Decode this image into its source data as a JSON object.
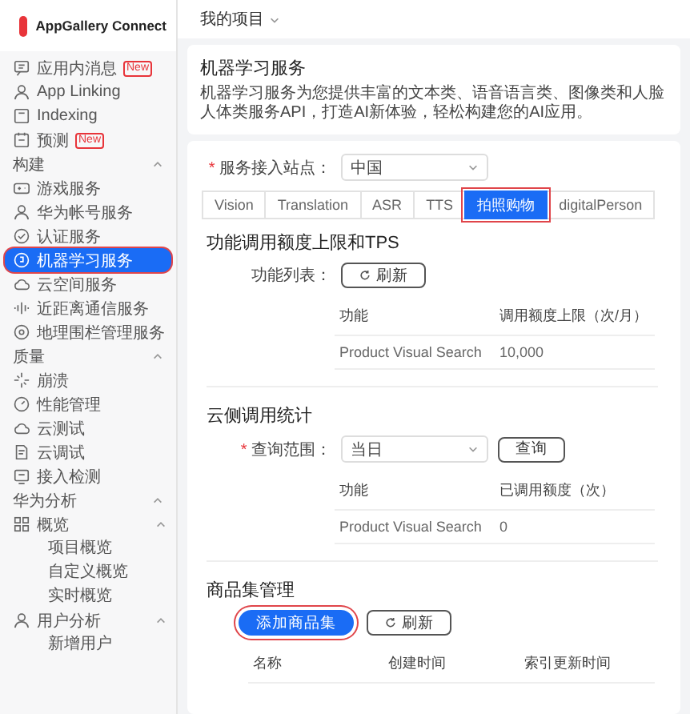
{
  "sidebar": {
    "brand": "AppGallery Connect",
    "groups": [
      {
        "items": [
          {
            "label": "应用内消息",
            "badge": "New",
            "selected": false,
            "highlighted": false
          },
          {
            "label": "App Linking",
            "selected": false,
            "highlighted": false
          },
          {
            "label": "Indexing",
            "selected": false,
            "highlighted": false
          },
          {
            "label": "预测",
            "badge": "New",
            "selected": false,
            "highlighted": false
          }
        ]
      },
      {
        "title": "构建",
        "expanded": true,
        "items": [
          {
            "label": "游戏服务",
            "selected": false,
            "highlighted": false
          },
          {
            "label": "华为帐号服务",
            "selected": false,
            "highlighted": false
          },
          {
            "label": "认证服务",
            "selected": false,
            "highlighted": false
          },
          {
            "label": "机器学习服务",
            "selected": true,
            "highlighted": true
          },
          {
            "label": "云空间服务",
            "selected": false,
            "highlighted": false
          },
          {
            "label": "近距离通信服务",
            "selected": false,
            "highlighted": false
          },
          {
            "label": "地理围栏管理服务",
            "selected": false,
            "highlighted": false
          }
        ]
      },
      {
        "title": "质量",
        "expanded": true,
        "items": [
          {
            "label": "崩溃",
            "selected": false,
            "highlighted": false
          },
          {
            "label": "性能管理",
            "selected": false,
            "highlighted": false
          },
          {
            "label": "云测试",
            "selected": false,
            "highlighted": false
          },
          {
            "label": "云调试",
            "selected": false,
            "highlighted": false
          },
          {
            "label": "接入检测",
            "selected": false,
            "highlighted": false
          }
        ]
      },
      {
        "title": "华为分析",
        "expanded": true,
        "items": [
          {
            "label": "概览",
            "selected": false,
            "highlighted": false,
            "expanded": true,
            "children": [
              {
                "label": "项目概览",
                "selected": false
              },
              {
                "label": "自定义概览",
                "selected": false
              },
              {
                "label": "实时概览",
                "selected": false
              }
            ]
          },
          {
            "label": "用户分析",
            "selected": false,
            "highlighted": false,
            "expanded": true,
            "children": [
              {
                "label": "新增用户",
                "selected": false
              }
            ]
          }
        ]
      }
    ]
  },
  "project_selector": {
    "label": "我的项目"
  },
  "intro": {
    "title": "机器学习服务",
    "description": "机器学习服务为您提供丰富的文本类、语音语言类、图像类和人脸人体类服务API，打造AI新体验，轻松构建您的AI应用。"
  },
  "site": {
    "required_mark": "*",
    "label": "服务接入站点：",
    "value": "中国"
  },
  "tabs": [
    {
      "label": "Vision",
      "selected": false,
      "highlighted": false
    },
    {
      "label": "Translation",
      "selected": false,
      "highlighted": false
    },
    {
      "label": "ASR",
      "selected": false,
      "highlighted": false
    },
    {
      "label": "TTS",
      "selected": false,
      "highlighted": false
    },
    {
      "label": "拍照购物",
      "selected": true,
      "highlighted": true
    },
    {
      "label": "digitalPerson",
      "selected": false,
      "highlighted": false
    }
  ],
  "quota": {
    "title": "功能调用额度上限和TPS",
    "list_label": "功能列表：",
    "refresh_button": "刷新",
    "table": {
      "columns": [
        "功能",
        "调用额度上限（次/月）"
      ],
      "rows": [
        [
          "Product Visual Search",
          "10,000"
        ]
      ]
    }
  },
  "stats": {
    "title": "云侧调用统计",
    "range": {
      "required_mark": "*",
      "label": "查询范围：",
      "value": "当日"
    },
    "query_button": "查询",
    "table": {
      "columns": [
        "功能",
        "已调用额度（次）"
      ],
      "rows": [
        [
          "Product Visual Search",
          "0"
        ]
      ]
    }
  },
  "product_sets": {
    "title": "商品集管理",
    "buttons": [
      {
        "label": "添加商品集",
        "kind": "primary",
        "highlighted": true
      },
      {
        "label": "刷新",
        "kind": "refresh",
        "highlighted": false
      }
    ],
    "table": {
      "columns": [
        "名称",
        "创建时间",
        "索引更新时间"
      ]
    }
  }
}
